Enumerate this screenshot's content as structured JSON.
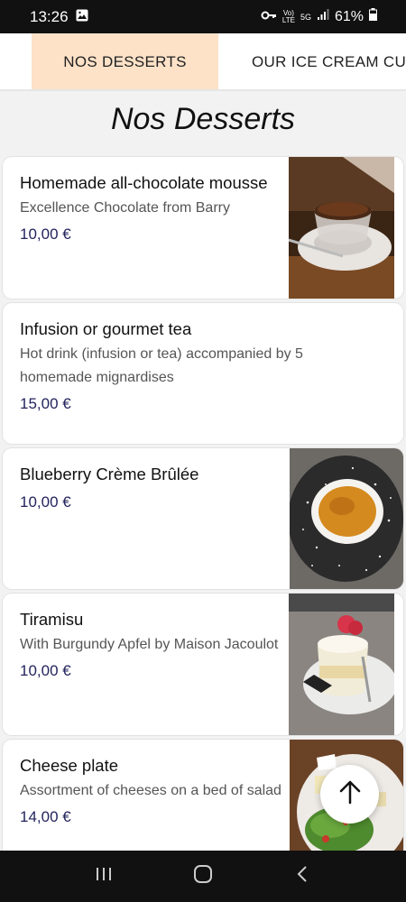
{
  "status": {
    "time": "13:26",
    "battery": "61%",
    "network": "5G",
    "volte": "VoLTE"
  },
  "tabs": [
    {
      "label": "NOS DESSERTS",
      "active": true
    },
    {
      "label": "OUR ICE CREAM CU",
      "active": false
    }
  ],
  "page_title": "Nos Desserts",
  "items": [
    {
      "title": "Homemade all-chocolate mousse",
      "desc": "Excellence Chocolate from Barry",
      "price": "10,00 €",
      "image": "chocolate-mousse"
    },
    {
      "title": "Infusion or gourmet tea",
      "desc": "Hot drink (infusion or tea) accompanied by 5 homemade mignardises",
      "price": "15,00 €",
      "image": null
    },
    {
      "title": "Blueberry Crème Brûlée",
      "desc": "",
      "price": "10,00 €",
      "image": "creme-brulee"
    },
    {
      "title": "Tiramisu",
      "desc": "With Burgundy Apfel by Maison Jacoulot",
      "price": "10,00 €",
      "image": "tiramisu"
    },
    {
      "title": "Cheese plate",
      "desc": "Assortment of cheeses on a bed of salad",
      "price": "14,00 €",
      "image": "cheese-salad"
    }
  ],
  "colors": {
    "active_tab": "#fde2c8",
    "price": "#23235e",
    "background": "#f2f2f2"
  }
}
